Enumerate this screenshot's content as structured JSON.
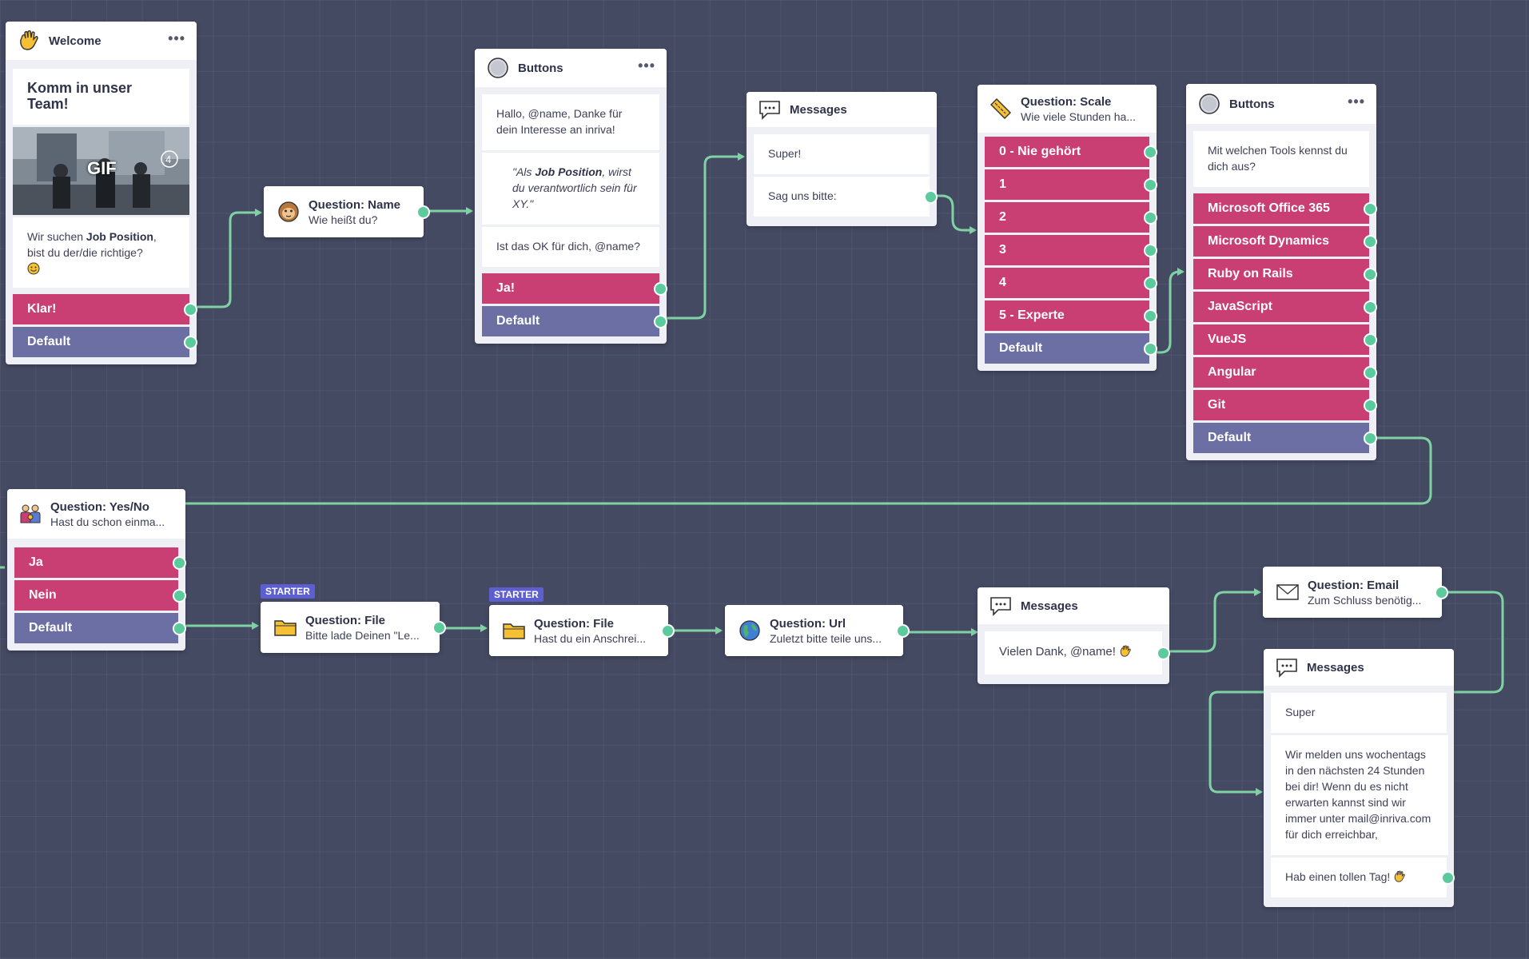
{
  "colors": {
    "canvas": "#454a63",
    "button": "#c93e73",
    "default_button": "#6b6fa4",
    "connector": "#7ed2a4",
    "port": "#5bcb9d",
    "starter_badge": "#5d5fd1"
  },
  "nodes": {
    "welcome": {
      "title": "Welcome",
      "icon": "waving-hand-icon",
      "headline": "Komm in unser Team!",
      "gif_label": "GIF",
      "text_pre": "Wir suchen ",
      "text_bold": "Job Position",
      "text_post": ", bist du der/die richtige?",
      "emoji": "smiling-face-icon",
      "buttons": [
        "Klar!",
        "Default"
      ]
    },
    "question_name": {
      "title": "Question: Name",
      "subtitle": "Wie heißt du?",
      "icon": "monkey-icon"
    },
    "buttons_1": {
      "title": "Buttons",
      "icon": "circle-icon",
      "messages": [
        "Hallo, @name, Danke für dein Interesse an inriva!",
        "Ist das OK für dich, @name?"
      ],
      "quote_pre": "\"Als ",
      "quote_bold": "Job Position",
      "quote_post": ", wirst du verantwortlich sein für XY.\"",
      "buttons": [
        "Ja!",
        "Default"
      ]
    },
    "messages_1": {
      "title": "Messages",
      "icon": "speech-bubble-icon",
      "messages": [
        "Super!",
        "Sag uns bitte:"
      ]
    },
    "question_scale": {
      "title": "Question: Scale",
      "subtitle": "Wie viele Stunden ha...",
      "icon": "ruler-icon",
      "buttons": [
        "0 - Nie gehört",
        "1",
        "2",
        "3",
        "4",
        "5 - Experte",
        "Default"
      ]
    },
    "buttons_2": {
      "title": "Buttons",
      "icon": "circle-icon",
      "message": "Mit welchen Tools kennst du dich aus?",
      "buttons": [
        "Microsoft Office 365",
        "Microsoft Dynamics",
        "Ruby on Rails",
        "JavaScript",
        "VueJS",
        "Angular",
        "Git",
        "Default"
      ]
    },
    "question_yesno": {
      "title": "Question: Yes/No",
      "subtitle": "Hast du schon einma...",
      "icon": "family-icon",
      "buttons": [
        "Ja",
        "Nein",
        "Default"
      ]
    },
    "question_file_1": {
      "badge": "STARTER",
      "title": "Question: File",
      "subtitle": "Bitte lade Deinen \"Le...",
      "icon": "folder-icon"
    },
    "question_file_2": {
      "badge": "STARTER",
      "title": "Question: File",
      "subtitle": "Hast du ein Anschrei...",
      "icon": "folder-icon"
    },
    "question_url": {
      "title": "Question: Url",
      "subtitle": "Zuletzt bitte teile uns...",
      "icon": "globe-icon"
    },
    "messages_2": {
      "title": "Messages",
      "icon": "speech-bubble-icon",
      "message": "Vielen Dank, @name!",
      "emoji": "waving-hand-icon"
    },
    "question_email": {
      "title": "Question: Email",
      "subtitle": "Zum Schluss benötig...",
      "icon": "envelope-icon"
    },
    "messages_3": {
      "title": "Messages",
      "icon": "speech-bubble-icon",
      "messages": [
        "Super",
        "Wir melden uns wochentags in den nächsten 24 Stunden bei dir! Wenn du es nicht erwarten kannst sind wir immer unter mail@inriva.com für dich erreichbar,",
        "Hab einen tollen Tag!"
      ],
      "emoji": "waving-hand-icon"
    }
  }
}
